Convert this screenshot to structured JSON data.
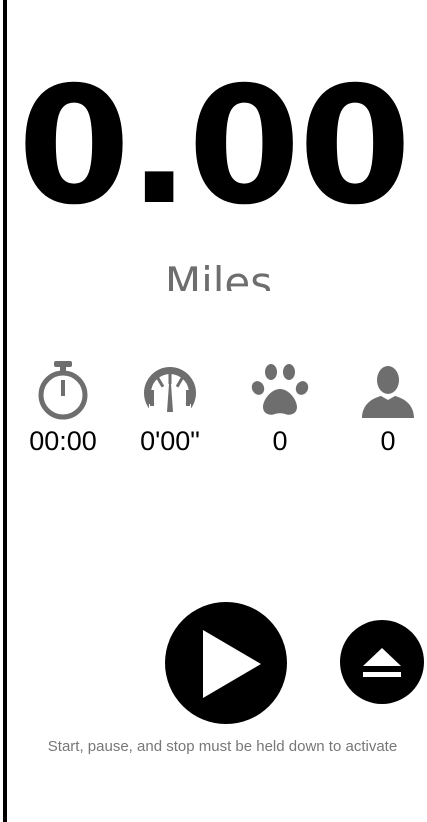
{
  "tracker": {
    "distance": "0.00",
    "unit": "Miles"
  },
  "stats": [
    {
      "icon": "stopwatch-icon",
      "value": "00:00"
    },
    {
      "icon": "speedometer-icon",
      "value": "0'00\""
    },
    {
      "icon": "paw-icon",
      "value": "0"
    },
    {
      "icon": "person-icon",
      "value": "0"
    }
  ],
  "controls": {
    "play_icon": "play-icon",
    "eject_icon": "eject-icon",
    "hint": "Start, pause, and stop must be held down to activate"
  },
  "colors": {
    "primary": "#000000",
    "icon_gray": "#6e6e6e",
    "hint_gray": "#777777",
    "background": "#ffffff"
  }
}
